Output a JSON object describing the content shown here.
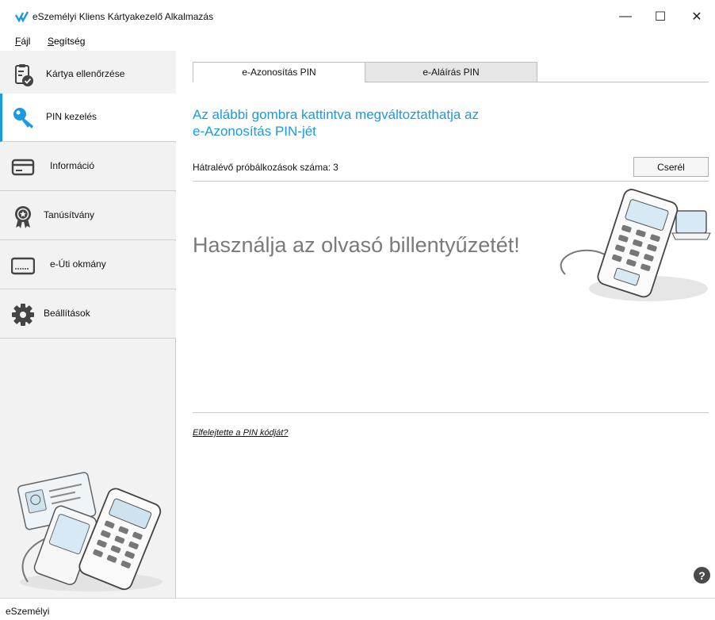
{
  "window": {
    "title": "eSzemélyi Kliens Kártyakezelő Alkalmazás",
    "minimize_glyph": "—",
    "maximize_glyph": "☐",
    "close_glyph": "✕"
  },
  "menu": {
    "file_first": "F",
    "file_rest": "ájl",
    "help_first": "S",
    "help_rest": "egítség"
  },
  "sidebar": {
    "items": [
      {
        "label": "Kártya ellenőrzése",
        "icon": "card-check-icon"
      },
      {
        "label": "PIN kezelés",
        "icon": "key-icon",
        "active": true
      },
      {
        "label": "Információ",
        "icon": "card-icon"
      },
      {
        "label": "Tanúsítvány",
        "icon": "certificate-badge-icon"
      },
      {
        "label": "e-Úti okmány",
        "icon": "passport-card-icon"
      },
      {
        "label": "Beállítások",
        "icon": "gear-icon"
      }
    ]
  },
  "tabs": [
    {
      "label": "e-Azonosítás PIN",
      "active": true
    },
    {
      "label": "e-Aláírás PIN",
      "active": false
    }
  ],
  "main": {
    "heading_line1": "Az alábbi gombra kattintva megváltoztathatja az",
    "heading_line2": "e-Azonosítás PIN-jét",
    "attempts_label": "Hátralévő próbálkozások száma:",
    "attempts_count": "3",
    "change_button": "Cserél",
    "reader_message": "Használja az olvasó billentyűzetét!",
    "forgot_link": "Elfelejtette a PIN kódját?",
    "help_glyph": "?"
  },
  "status": {
    "text": "eSzemélyi"
  },
  "colors": {
    "accent": "#1a9be0",
    "sidebar_bg": "#f2f2f2",
    "message_gray": "#7a7a7a"
  }
}
